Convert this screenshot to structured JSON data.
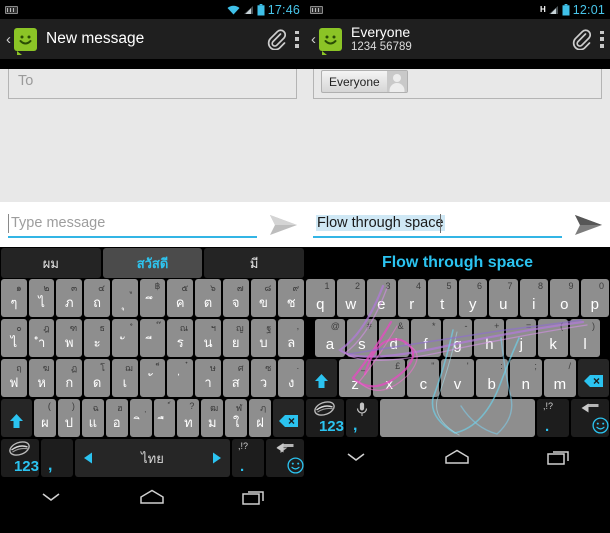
{
  "left": {
    "statusbar": {
      "keyboard_icon": "keyboard-icon",
      "wifi_icon": "wifi-icon",
      "signal_icon": "signal-icon",
      "battery_icon": "battery-icon",
      "clock": "17:46",
      "clock_color": "#48c5ea"
    },
    "actionbar": {
      "back_glyph": "‹",
      "app_icon": "messaging-app-icon",
      "title": "New message",
      "attach_icon": "paperclip-icon",
      "overflow_icon": "overflow-menu-icon"
    },
    "compose": {
      "to_placeholder": "To"
    },
    "input": {
      "placeholder": "Type message",
      "value": "",
      "send_icon": "send-icon",
      "underline_color": "#33b5e5"
    },
    "suggestions": [
      {
        "text": "ผม",
        "active": false
      },
      {
        "text": "สวัสดี",
        "active": true
      },
      {
        "text": "มี",
        "active": false
      }
    ],
    "keyboard": {
      "layout": "thai",
      "rows": [
        [
          {
            "main": "ๆ",
            "alt": "๑"
          },
          {
            "main": "ไ",
            "alt": "๒"
          },
          {
            "main": "ภ",
            "alt": "๓"
          },
          {
            "main": "ถ",
            "alt": "๔"
          },
          {
            "main": "ุ",
            "alt": "ู"
          },
          {
            "main": "ึ",
            "alt": "฿"
          },
          {
            "main": "ค",
            "alt": "๕"
          },
          {
            "main": "ต",
            "alt": "๖"
          },
          {
            "main": "จ",
            "alt": "๗"
          },
          {
            "main": "ข",
            "alt": "๘"
          },
          {
            "main": "ช",
            "alt": "๙"
          }
        ],
        [
          {
            "main": "ไ",
            "alt": "๐"
          },
          {
            "main": "ำ",
            "alt": "ฎ"
          },
          {
            "main": "พ",
            "alt": "ฑ"
          },
          {
            "main": "ะ",
            "alt": "ธ"
          },
          {
            "main": "ั",
            "alt": "ํ"
          },
          {
            "main": "ี",
            "alt": "๊"
          },
          {
            "main": "ร",
            "alt": "ณ"
          },
          {
            "main": "น",
            "alt": "ฯ"
          },
          {
            "main": "ย",
            "alt": "ญ"
          },
          {
            "main": "บ",
            "alt": "ฐ"
          },
          {
            "main": "ล",
            "alt": ","
          }
        ],
        [
          {
            "main": "ฟ",
            "alt": "ฤ"
          },
          {
            "main": "ห",
            "alt": "ฆ"
          },
          {
            "main": "ก",
            "alt": "ฏ"
          },
          {
            "main": "ด",
            "alt": "โ"
          },
          {
            "main": "เ",
            "alt": "ฌ"
          },
          {
            "main": "้",
            "alt": "็"
          },
          {
            "main": "่",
            "alt": "๋"
          },
          {
            "main": "า",
            "alt": "ษ"
          },
          {
            "main": "ส",
            "alt": "ศ"
          },
          {
            "main": "ว",
            "alt": "ซ"
          },
          {
            "main": "ง",
            "alt": "."
          }
        ],
        [
          {
            "main": "ผ",
            "alt": "("
          },
          {
            "main": "ป",
            "alt": ")"
          },
          {
            "main": "แ",
            "alt": "ฉ"
          },
          {
            "main": "อ",
            "alt": "ฮ"
          },
          {
            "main": "ิ",
            "alt": "ฺ"
          },
          {
            "main": "ื",
            "alt": "์"
          },
          {
            "main": "ท",
            "alt": "?"
          },
          {
            "main": "ม",
            "alt": "ฒ"
          },
          {
            "main": "ใ",
            "alt": "ฬ"
          },
          {
            "main": "ฝ",
            "alt": "ฦ"
          }
        ]
      ],
      "shift_icon": "shift-icon",
      "backspace_icon": "backspace-icon",
      "fn_row": {
        "num_label": "123",
        "swype_icon": "swype-logo-icon",
        "comma_label": ",",
        "space_label": "ไทย",
        "arrow_left_icon": "arrow-left-icon",
        "arrow_right_icon": "arrow-right-icon",
        "punct_main": ".",
        "punct_alt": ",!?",
        "enter_icon": "enter-icon",
        "emoji_icon": "emoji-icon"
      }
    },
    "navbar": {
      "back_icon": "hide-keyboard-icon",
      "home_icon": "home-icon",
      "recents_icon": "recents-icon"
    }
  },
  "right": {
    "statusbar": {
      "keyboard_icon": "keyboard-icon",
      "network_type": "H",
      "signal_icon": "signal-icon",
      "battery_icon": "battery-icon",
      "clock": "12:01",
      "clock_color": "#48c5ea"
    },
    "actionbar": {
      "back_glyph": "‹",
      "app_icon": "messaging-app-icon",
      "title": "Everyone",
      "subtitle": "1234 56789",
      "attach_icon": "paperclip-icon",
      "overflow_icon": "overflow-menu-icon"
    },
    "compose": {
      "chip_label": "Everyone",
      "chip_avatar_icon": "contact-avatar-icon"
    },
    "input": {
      "value": "Flow through space",
      "send_icon": "send-icon",
      "underline_color": "#33b5e5",
      "highlight_color": "#cfe8f5"
    },
    "banner": {
      "text": "Flow through space",
      "color": "#2bc3f0"
    },
    "keyboard": {
      "layout": "qwerty",
      "rows": [
        [
          {
            "main": "q",
            "alt": "1"
          },
          {
            "main": "w",
            "alt": "2"
          },
          {
            "main": "e",
            "alt": "3"
          },
          {
            "main": "r",
            "alt": "4"
          },
          {
            "main": "t",
            "alt": "5"
          },
          {
            "main": "y",
            "alt": "6"
          },
          {
            "main": "u",
            "alt": "7"
          },
          {
            "main": "i",
            "alt": "8"
          },
          {
            "main": "o",
            "alt": "9"
          },
          {
            "main": "p",
            "alt": "0"
          }
        ],
        [
          {
            "main": "a",
            "alt": "@"
          },
          {
            "main": "s",
            "alt": "#"
          },
          {
            "main": "d",
            "alt": "&"
          },
          {
            "main": "f",
            "alt": "*"
          },
          {
            "main": "g",
            "alt": "-"
          },
          {
            "main": "h",
            "alt": "+"
          },
          {
            "main": "j",
            "alt": "="
          },
          {
            "main": "k",
            "alt": "("
          },
          {
            "main": "l",
            "alt": ")"
          }
        ],
        [
          {
            "main": "z",
            "alt": "_"
          },
          {
            "main": "x",
            "alt": "£"
          },
          {
            "main": "c",
            "alt": "\""
          },
          {
            "main": "v",
            "alt": "'"
          },
          {
            "main": "b",
            "alt": ":"
          },
          {
            "main": "n",
            "alt": ";"
          },
          {
            "main": "m",
            "alt": "/"
          }
        ]
      ],
      "shift_icon": "shift-icon",
      "backspace_icon": "backspace-icon",
      "fn_row": {
        "num_label": "123",
        "swype_icon": "swype-logo-icon",
        "comma_label": ",",
        "mic_icon": "microphone-icon",
        "space_label": "",
        "punct_main": ".",
        "punct_alt": ",!?",
        "enter_icon": "enter-icon",
        "emoji_icon": "emoji-icon"
      },
      "swipe_trail": "swipe-gesture-trail"
    },
    "navbar": {
      "back_icon": "hide-keyboard-icon",
      "home_icon": "home-icon",
      "recents_icon": "recents-icon"
    }
  }
}
